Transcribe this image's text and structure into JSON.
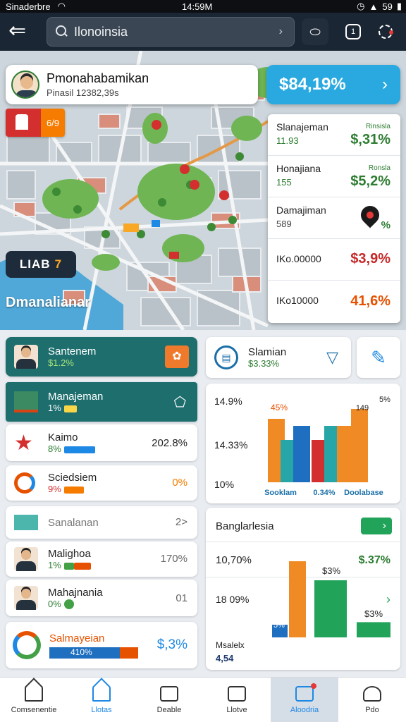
{
  "status_bar": {
    "carrier": "Sinaderbre",
    "time": "14:59M",
    "battery": "59"
  },
  "search": {
    "query": "Ilonoinsia"
  },
  "profile": {
    "name": "Pmonahabamikan",
    "subtitle": "Pinasil 12382,39s"
  },
  "banner": {
    "value": "$84,19%"
  },
  "flag_tag": "6/9",
  "map_tag": {
    "text": "LIAB",
    "num": "7"
  },
  "map_label": "Dmanalianar",
  "stats": [
    {
      "name": "Slanajeman",
      "sub": "11.93",
      "tag": "Rinsisla",
      "value": "$,31%",
      "color": "#2e7d32"
    },
    {
      "name": "Honajiana",
      "sub": "155",
      "tag": "Ronsla",
      "value": "$5,2%",
      "color": "#2e7d32"
    },
    {
      "name": "Damajiman",
      "sub": "589",
      "tag": "",
      "value": "%",
      "color": "#2e7d32"
    },
    {
      "name": "IKo.00000",
      "sub": "",
      "tag": "",
      "value": "$3,9%",
      "color": "#c62828"
    },
    {
      "name": "IKo10000",
      "sub": "",
      "tag": "",
      "value": "41,6%",
      "color": "#e65100"
    }
  ],
  "left_cards": [
    {
      "name": "Santenem",
      "sub": "$1.2%"
    },
    {
      "name": "Manajeman",
      "sub": "1%"
    },
    {
      "name": "Kaimo",
      "sub": "8%",
      "value": "202.8%"
    },
    {
      "name": "Sciedsiem",
      "sub": "9%",
      "value": "0%"
    },
    {
      "name": "Sanalanan",
      "sub": "",
      "value": "2>"
    },
    {
      "name": "Malighoa",
      "sub": "1%",
      "value": "170%"
    },
    {
      "name": "Mahajnania",
      "sub": "0%",
      "value": "01"
    },
    {
      "name": "Salmayeian",
      "sub": "410%",
      "value": "$,3%"
    }
  ],
  "card_top_right": {
    "name": "Slamian",
    "sub": "$3.33%"
  },
  "chart1_labels": {
    "y_ticks": [
      "14.9%",
      "14.33%",
      "10%"
    ],
    "bottom": [
      "Sooklam",
      "0.34%",
      "Doolabase"
    ],
    "top": [
      "45%",
      "149",
      "5%"
    ]
  },
  "chart2": {
    "title": "Banglarlesia",
    "rows": [
      {
        "label": "10,70%",
        "value": "$.37%"
      },
      {
        "label": "18 09%",
        "value": ""
      }
    ],
    "bar_labels": [
      "$3%",
      "$3%"
    ],
    "footer_l": "Msalelx",
    "footer_v": "4,54",
    "bar_tag": "5%"
  },
  "chart_data": [
    {
      "type": "bar",
      "categories": [
        "Sooklam",
        "0.34%",
        "Doolabase"
      ],
      "series": [
        {
          "values": [
            45,
            30
          ]
        },
        {
          "values": [
            30,
            40
          ]
        },
        {
          "values": [
            40,
            40,
            52
          ]
        }
      ]
    },
    {
      "type": "bar",
      "title": "Banglarlesia",
      "values": [
        10,
        60,
        45,
        12
      ]
    }
  ],
  "bottom_nav": [
    {
      "label": "Comsenentie"
    },
    {
      "label": "Llotas"
    },
    {
      "label": "Deable"
    },
    {
      "label": "Llotve"
    },
    {
      "label": "Aloodria"
    },
    {
      "label": "Pdo"
    }
  ]
}
